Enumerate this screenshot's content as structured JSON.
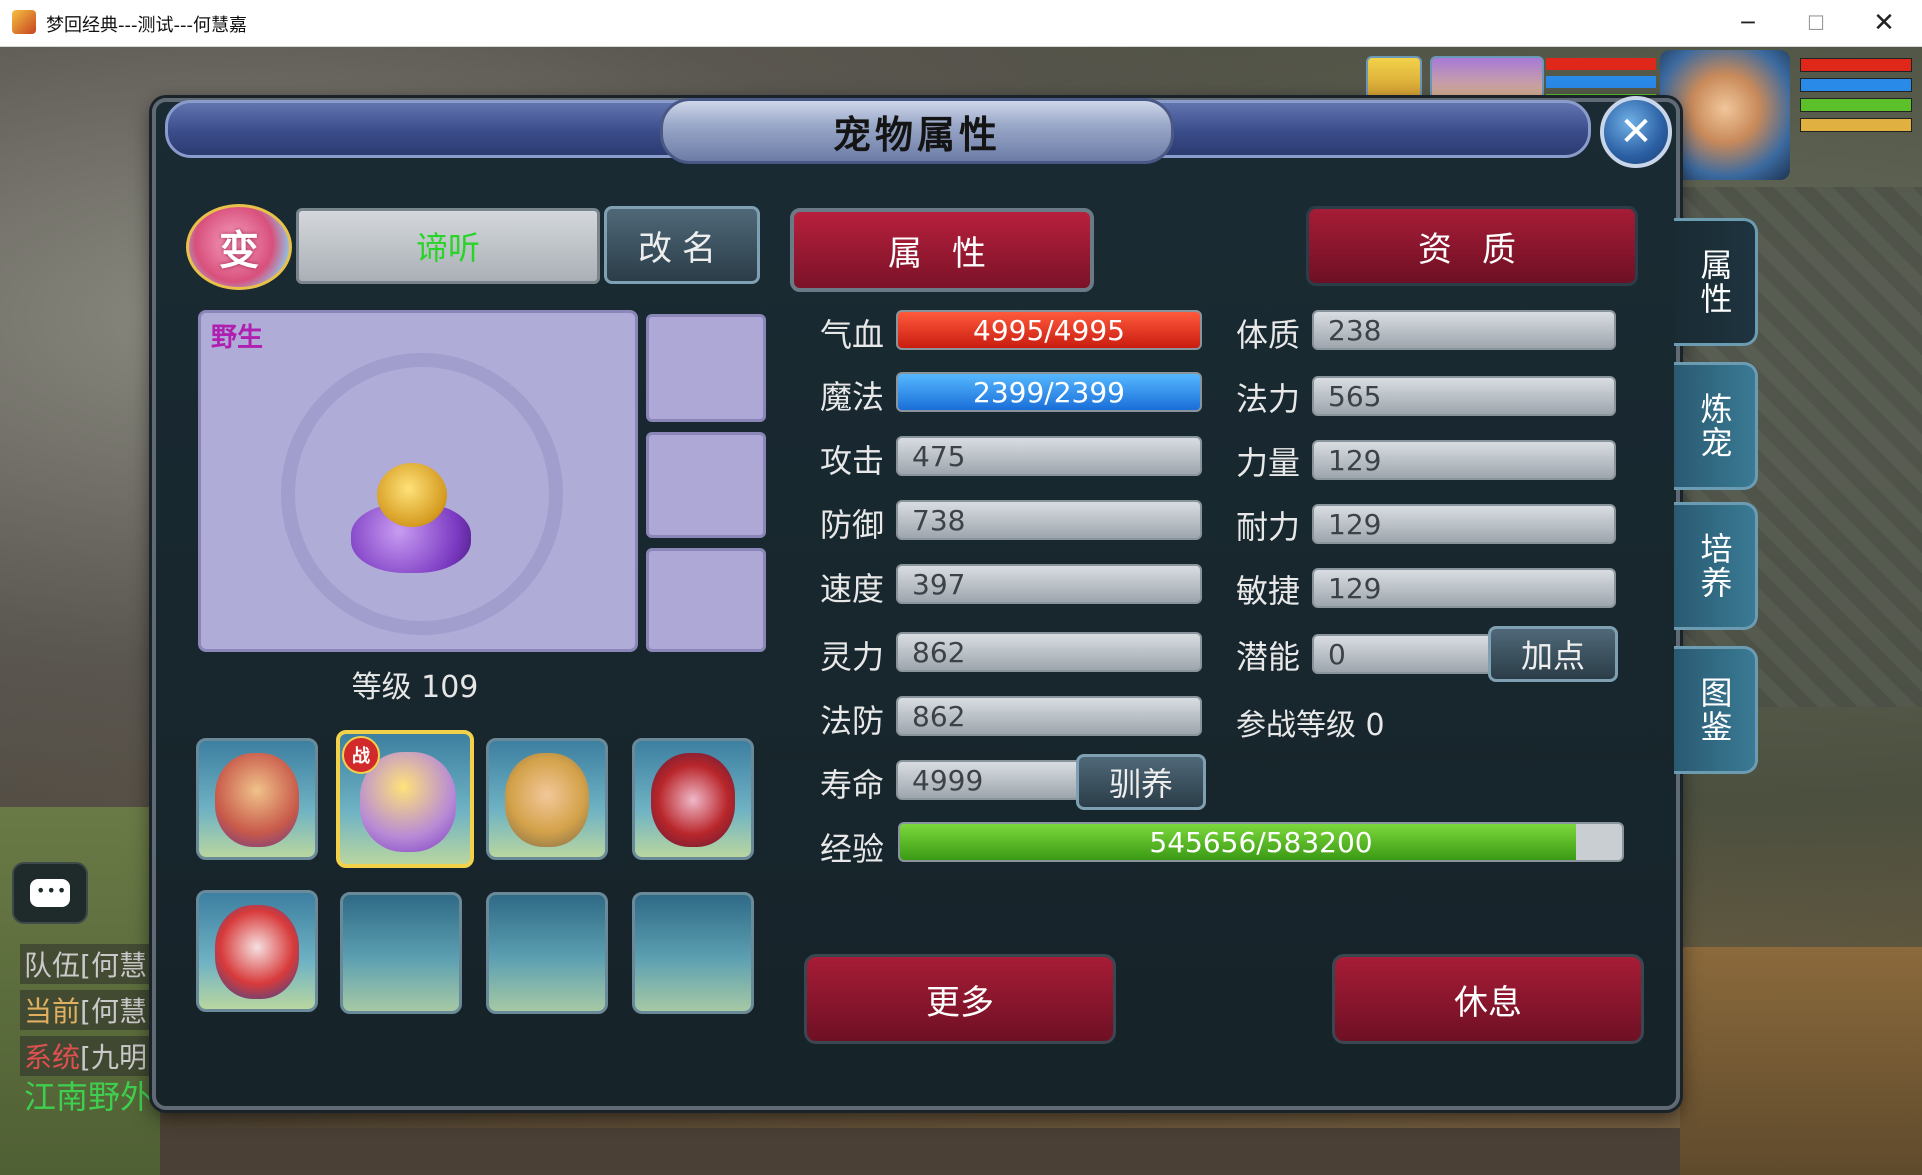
{
  "window": {
    "title": "梦回经典---测试---何慧嘉",
    "minimize": "─",
    "maximize": "☐",
    "close": "✕"
  },
  "chat": {
    "lines": [
      {
        "tag": "队伍",
        "text": "[何慧"
      },
      {
        "tag": "当前",
        "text": "[何慧"
      },
      {
        "tag": "系统",
        "text": "[九明"
      }
    ],
    "location": "江南野外"
  },
  "panel": {
    "title": "宠物属性",
    "close_icon": "✕",
    "transform_badge": "变",
    "pet_name": "谛听",
    "rename_label": "改名",
    "wild_label": "野生",
    "level_label": "等级 109",
    "battle_badge": "战",
    "tabs": {
      "attributes": "属性",
      "aptitude": "资质"
    },
    "side_tabs": [
      "属性",
      "炼宠",
      "培养",
      "图鉴"
    ],
    "stats_left": [
      {
        "label": "气血",
        "value": "4995/4995"
      },
      {
        "label": "魔法",
        "value": "2399/2399"
      },
      {
        "label": "攻击",
        "value": "475"
      },
      {
        "label": "防御",
        "value": "738"
      },
      {
        "label": "速度",
        "value": "397"
      },
      {
        "label": "灵力",
        "value": "862"
      },
      {
        "label": "法防",
        "value": "862"
      },
      {
        "label": "寿命",
        "value": "4999"
      }
    ],
    "stats_right": [
      {
        "label": "体质",
        "value": "238"
      },
      {
        "label": "法力",
        "value": "565"
      },
      {
        "label": "力量",
        "value": "129"
      },
      {
        "label": "耐力",
        "value": "129"
      },
      {
        "label": "敏捷",
        "value": "129"
      },
      {
        "label": "潜能",
        "value": "0"
      }
    ],
    "add_points_label": "加点",
    "tame_label": "驯养",
    "battle_level": "参战等级  0",
    "exp": {
      "label": "经验",
      "value": "545656/583200",
      "current": 545656,
      "max": 583200
    },
    "more_label": "更多",
    "rest_label": "休息"
  },
  "colors": {
    "hp": "#e0281a",
    "mp": "#2a8ae8",
    "exp": "#5cc02a",
    "button_red": "#a61c36",
    "name_green": "#28d428"
  }
}
